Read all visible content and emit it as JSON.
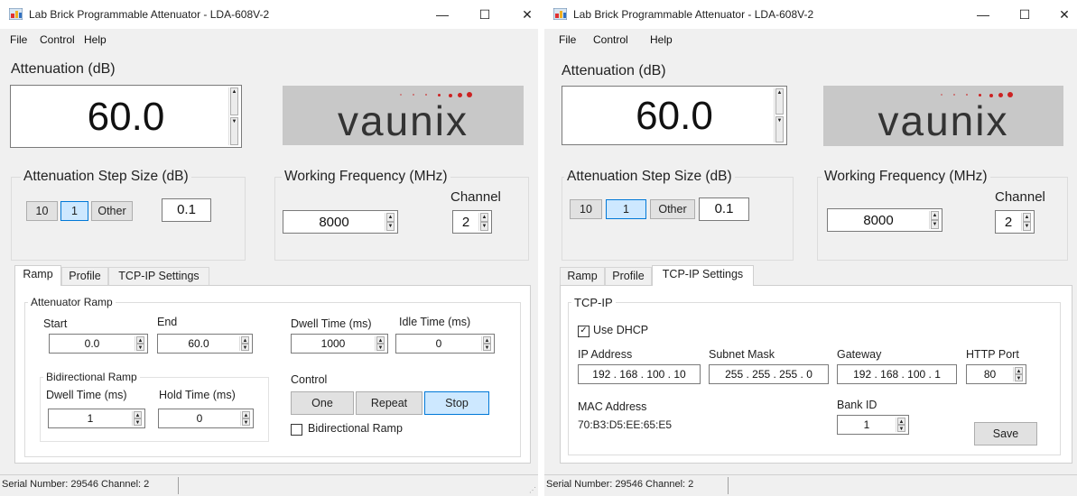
{
  "window1": {
    "title": "Lab Brick Programmable Attenuator - LDA-608V-2",
    "controls": {
      "minimize": "—",
      "maximize": "☐",
      "close": "✕"
    },
    "menu": [
      "File",
      "Control",
      "Help"
    ],
    "attenuation_label": "Attenuation (dB)",
    "attenuation_value": "60.0",
    "logo_text": "vaunix",
    "step_size": {
      "title": "Attenuation Step Size (dB)",
      "buttons": [
        "10",
        "1",
        "Other"
      ],
      "selected": "1",
      "other_value": "0.1"
    },
    "frequency": {
      "title": "Working Frequency (MHz)",
      "value": "8000",
      "channel_label": "Channel",
      "channel_value": "2"
    },
    "tabs": [
      "Ramp",
      "Profile",
      "TCP-IP Settings"
    ],
    "active_tab": "Ramp",
    "ramp": {
      "group_title": "Attenuator Ramp",
      "start_label": "Start",
      "start_value": "0.0",
      "end_label": "End",
      "end_value": "60.0",
      "dwell_label": "Dwell Time (ms)",
      "dwell_value": "1000",
      "idle_label": "Idle Time (ms)",
      "idle_value": "0",
      "bidir_group_title": "Bidirectional Ramp",
      "bidir_dwell_label": "Dwell Time (ms)",
      "bidir_dwell_value": "1",
      "hold_label": "Hold Time (ms)",
      "hold_value": "0",
      "control_label": "Control",
      "control_buttons": [
        "One",
        "Repeat",
        "Stop"
      ],
      "control_selected": "Stop",
      "bidir_checkbox_label": "Bidirectional Ramp",
      "bidir_checked": false
    },
    "status": "Serial Number: 29546 Channel: 2"
  },
  "window2": {
    "title": "Lab Brick Programmable Attenuator - LDA-608V-2",
    "controls": {
      "minimize": "—",
      "maximize": "☐",
      "close": "✕"
    },
    "menu": [
      "File",
      "Control",
      "Help"
    ],
    "attenuation_label": "Attenuation (dB)",
    "attenuation_value": "60.0",
    "logo_text": "vaunix",
    "step_size": {
      "title": "Attenuation Step Size (dB)",
      "buttons": [
        "10",
        "1",
        "Other"
      ],
      "selected": "1",
      "other_value": "0.1"
    },
    "frequency": {
      "title": "Working Frequency (MHz)",
      "value": "8000",
      "channel_label": "Channel",
      "channel_value": "2"
    },
    "tabs": [
      "Ramp",
      "Profile",
      "TCP-IP Settings"
    ],
    "active_tab": "TCP-IP Settings",
    "tcpip": {
      "group_title": "TCP-IP",
      "dhcp_label": "Use DHCP",
      "dhcp_checked": true,
      "ip_label": "IP Address",
      "ip_value": "192 . 168 . 100 . 10",
      "subnet_label": "Subnet Mask",
      "subnet_value": "255 . 255 . 255 . 0",
      "gateway_label": "Gateway",
      "gateway_value": "192 . 168 . 100 . 1",
      "http_label": "HTTP Port",
      "http_value": "80",
      "mac_label": "MAC Address",
      "mac_value": "70:B3:D5:EE:65:E5",
      "bank_label": "Bank ID",
      "bank_value": "1",
      "save_label": "Save"
    },
    "status": "Serial Number: 29546 Channel: 2"
  },
  "colors": {
    "accent": "#0078d7",
    "selected_fill": "#cde8ff",
    "logo_bg": "#c8c8c8",
    "logo_dot": "#cc2222",
    "window_bg": "#f0f0f0"
  }
}
